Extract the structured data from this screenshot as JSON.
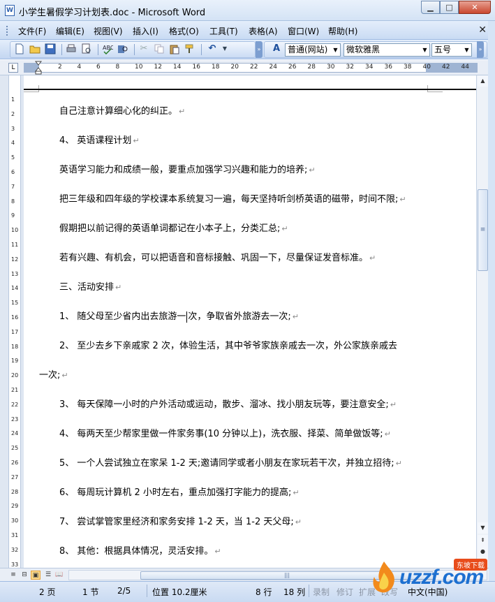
{
  "window": {
    "title": "小学生暑假学习计划表.doc - Microsoft Word",
    "app_icon": "W",
    "min_label": "▁",
    "max_label": "□",
    "close_label": "✕"
  },
  "menu": {
    "items": [
      "文件(F)",
      "编辑(E)",
      "视图(V)",
      "插入(I)",
      "格式(O)",
      "工具(T)",
      "表格(A)",
      "窗口(W)",
      "帮助(H)"
    ],
    "close_doc": "✕"
  },
  "toolbar": {
    "style": "普通(网站)",
    "font": "微软雅黑",
    "size": "五号",
    "icons": [
      "new-icon",
      "open-icon",
      "save-icon",
      "print-icon",
      "print-preview-icon",
      "spelling-icon",
      "research-icon",
      "cut-icon",
      "copy-icon",
      "paste-icon",
      "format-painter-icon",
      "undo-icon"
    ]
  },
  "ruler": {
    "numbers": [
      "2",
      "4",
      "6",
      "8",
      "10",
      "12",
      "14",
      "16",
      "18",
      "20",
      "22",
      "24",
      "26",
      "28",
      "30",
      "32",
      "34",
      "36",
      "38",
      "40",
      "42",
      "44"
    ],
    "corner": "L"
  },
  "vruler": {
    "numbers": [
      "1",
      "2",
      "3",
      "4",
      "5",
      "6",
      "7",
      "8",
      "9",
      "10",
      "11",
      "12",
      "13",
      "14",
      "15",
      "16",
      "17",
      "18",
      "19",
      "20",
      "21",
      "22",
      "23",
      "24",
      "25",
      "26",
      "27",
      "28",
      "29",
      "30",
      "31",
      "32",
      "33"
    ]
  },
  "document": {
    "mark": "↵",
    "lines": [
      "自己注意计算细心化的纠正。",
      "4、  英语课程计划",
      "英语学习能力和成绩一般，要重点加强学习兴趣和能力的培养;",
      "把三年级和四年级的学校课本系统复习一遍，每天坚持听剑桥英语的磁带，时间不限;",
      "假期把以前记得的英语单词都记在小本子上，分类汇总;",
      "若有兴趣、有机会，可以把语音和音标接触、巩固一下，尽量保证发音标准。",
      "三、活动安排",
      "2、  至少去乡下亲戚家 2 次，体验生活，其中爷爷家族亲戚去一次，外公家族亲戚去",
      "一次;",
      "3、  每天保障一小时的户外活动或运动，散步、溜冰、找小朋友玩等，要注意安全;",
      "4、  每两天至少帮家里做一件家务事(10 分钟以上)，洗衣服、择菜、简单做饭等;",
      "5、  一个人尝试独立在家呆 1-2 天;邀请同学或者小朋友在家玩若干次，并独立招待;",
      "6、  每周玩计算机 2 小时左右，重点加强打字能力的提高;",
      "7、  尝试掌管家里经济和家务安排 1-2 天，当 1-2 天父母;",
      "8、  其他：根据具体情况，灵活安排。"
    ],
    "cursor_line_before": "1、  随父母至少省内出去旅游一",
    "cursor_line_after": "次，争取省外旅游去一次;"
  },
  "status": {
    "page": "2 页",
    "section": "1 节",
    "page_of": "2/5",
    "position": "位置 10.2厘米",
    "line": "8 行",
    "column": "18 列",
    "rec": "录制",
    "trk": "修订",
    "ext": "扩展",
    "ovr": "改写",
    "lang": "中文(中国)"
  },
  "logo": {
    "text": "uzzf.com",
    "sub": "东坡下载"
  }
}
